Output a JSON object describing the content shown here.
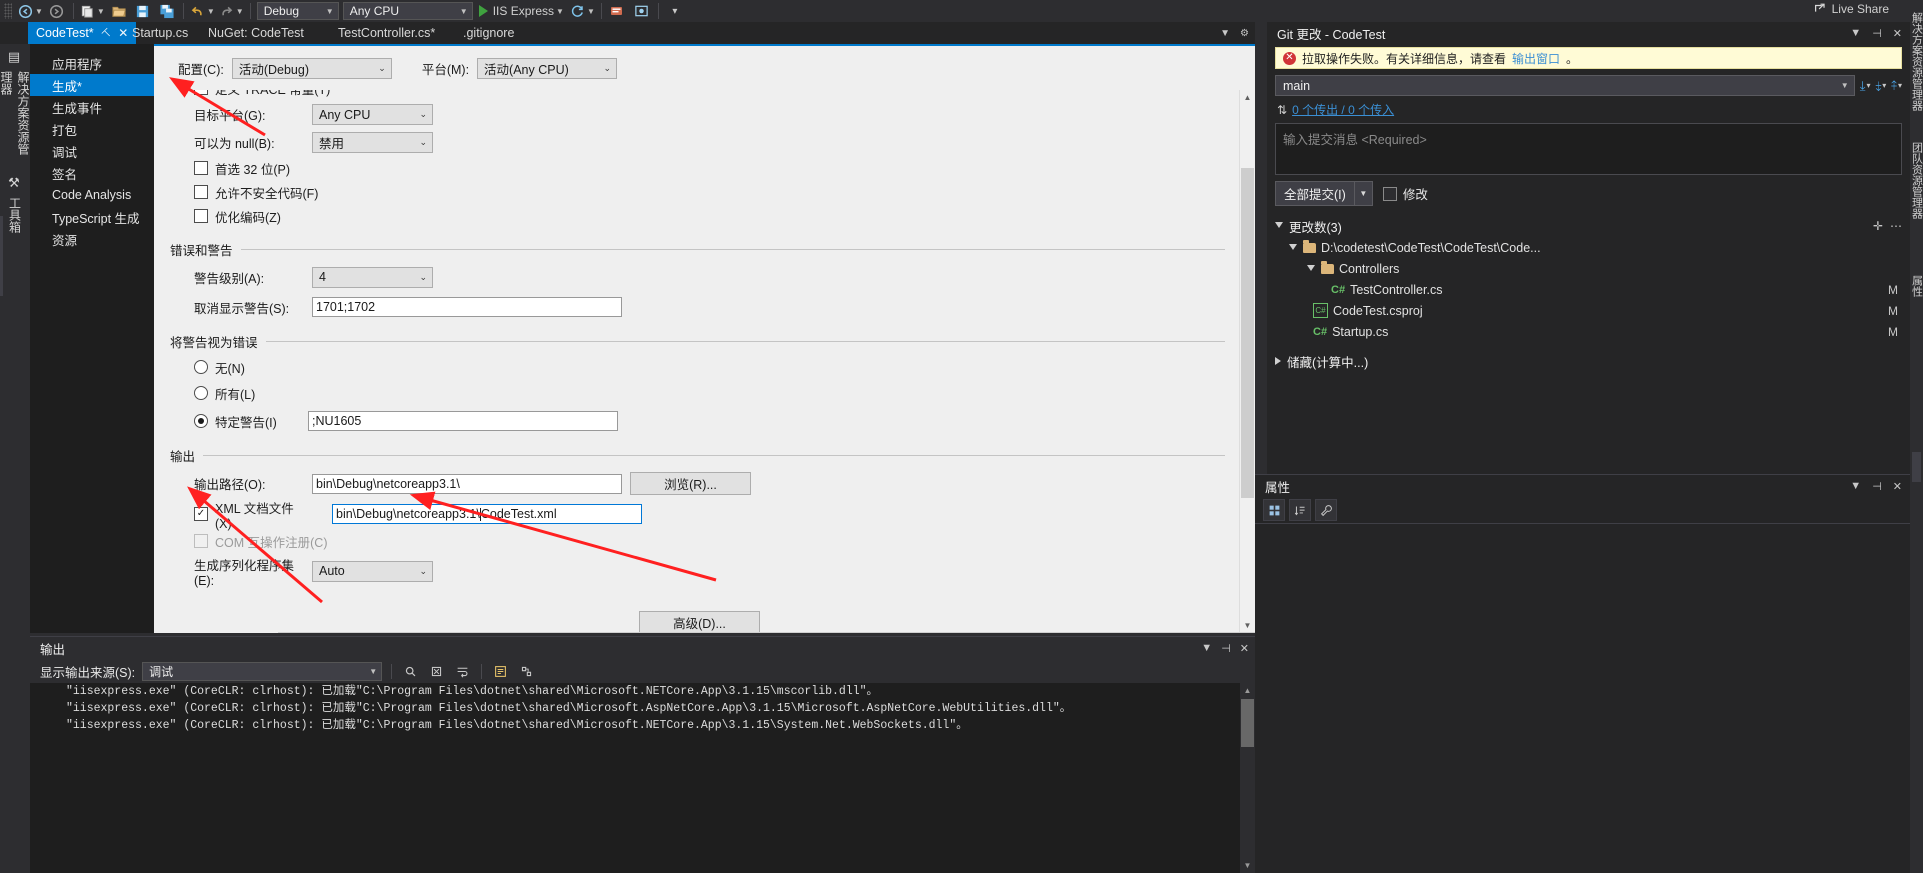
{
  "toolbar": {
    "nav_back": "back-arrow",
    "nav_fwd": "forward-arrow",
    "config": "Debug",
    "platform": "Any CPU",
    "run_target": "IIS Express",
    "live_share": "Live Share"
  },
  "tabs": [
    {
      "label": "CodeTest*",
      "active": true,
      "pinned": true,
      "closable": true
    },
    {
      "label": "Startup.cs",
      "active": false
    },
    {
      "label": "NuGet: CodeTest",
      "active": false
    },
    {
      "label": "TestController.cs*",
      "active": false
    },
    {
      "label": ".gitignore",
      "active": false
    }
  ],
  "left_dock": {
    "solution_explorer": "解决方案资源管理器",
    "toolbox": "工具箱"
  },
  "right_dock": {
    "tabs": [
      "解决方案资源管理器",
      "团队资源管理器",
      "属性"
    ]
  },
  "properties_page": {
    "nav": [
      {
        "label": "应用程序",
        "selected": false
      },
      {
        "label": "生成*",
        "selected": true
      },
      {
        "label": "生成事件",
        "selected": false
      },
      {
        "label": "打包",
        "selected": false
      },
      {
        "label": "调试",
        "selected": false
      },
      {
        "label": "签名",
        "selected": false
      },
      {
        "label": "Code Analysis",
        "selected": false
      },
      {
        "label": "TypeScript 生成",
        "selected": false
      },
      {
        "label": "资源",
        "selected": false
      }
    ],
    "config_label": "配置(C):",
    "config_value": "活动(Debug)",
    "platform_label": "平台(M):",
    "platform_value": "活动(Any CPU)",
    "trace_checkbox": {
      "label": "定义 TRACE 常量(T)",
      "checked": true
    },
    "target_platform": {
      "label": "目标平台(G):",
      "value": "Any CPU"
    },
    "nullable": {
      "label": "可以为 null(B):",
      "value": "禁用"
    },
    "prefer32": {
      "label": "首选 32 位(P)",
      "checked": false
    },
    "unsafe_code": {
      "label": "允许不安全代码(F)",
      "checked": false
    },
    "optimize_code": {
      "label": "优化编码(Z)",
      "checked": false
    },
    "errors_warnings_header": "错误和警告",
    "warning_level": {
      "label": "警告级别(A):",
      "value": "4"
    },
    "suppress_warnings": {
      "label": "取消显示警告(S):",
      "value": "1701;1702"
    },
    "warnings_as_errors_header": "将警告视为错误",
    "wae_none": {
      "label": "无(N)",
      "selected": false
    },
    "wae_all": {
      "label": "所有(L)",
      "selected": false
    },
    "wae_specific": {
      "label": "特定警告(I)",
      "selected": true,
      "value": ";NU1605"
    },
    "output_header": "输出",
    "output_path": {
      "label": "输出路径(O):",
      "value": "bin\\Debug\\netcoreapp3.1\\"
    },
    "browse_button": "浏览(R)...",
    "xml_doc": {
      "label": "XML 文档文件(X)",
      "checked": true,
      "value_before_caret": "bin\\Debug\\netcoreapp3.1\\",
      "value_after_caret": "CodeTest.xml"
    },
    "com_interop": {
      "label": "COM 互操作注册(C)",
      "checked": false,
      "disabled": true
    },
    "serialization": {
      "label": "生成序列化程序集(E):",
      "value": "Auto"
    },
    "advanced_button": "高级(D)..."
  },
  "output_window": {
    "title": "输出",
    "source_label": "显示输出来源(S):",
    "source_value": "调试",
    "lines": [
      "\"iisexpress.exe\" (CoreCLR: clrhost): 已加载\"C:\\Program Files\\dotnet\\shared\\Microsoft.NETCore.App\\3.1.15\\mscorlib.dll\"。",
      "\"iisexpress.exe\" (CoreCLR: clrhost): 已加载\"C:\\Program Files\\dotnet\\shared\\Microsoft.AspNetCore.App\\3.1.15\\Microsoft.AspNetCore.WebUtilities.dll\"。",
      "\"iisexpress.exe\" (CoreCLR: clrhost): 已加载\"C:\\Program Files\\dotnet\\shared\\Microsoft.NETCore.App\\3.1.15\\System.Net.WebSockets.dll\"。"
    ]
  },
  "git_panel": {
    "title": "Git 更改 - CodeTest",
    "alert": {
      "text_before": "拉取操作失败。有关详细信息，请查看 ",
      "link": "输出窗口",
      "text_after": "。"
    },
    "branch": "main",
    "sync_status": "0 个传出 / 0 个传入",
    "commit_placeholder": "输入提交消息 <Required>",
    "commit_button": "全部提交(I)",
    "amend_label": "修改",
    "changes_header": "更改数(3)",
    "root_path": "D:\\codetest\\CodeTest\\CodeTest\\Code...",
    "controllers_folder": "Controllers",
    "files": [
      {
        "name": "TestController.cs",
        "status": "M",
        "kind": "cs",
        "indent": 3
      },
      {
        "name": "CodeTest.csproj",
        "status": "M",
        "kind": "proj",
        "indent": 2
      },
      {
        "name": "Startup.cs",
        "status": "M",
        "kind": "cs",
        "indent": 2
      }
    ],
    "stash_header": "储藏(计算中...)"
  },
  "properties_panel": {
    "title": "属性"
  }
}
